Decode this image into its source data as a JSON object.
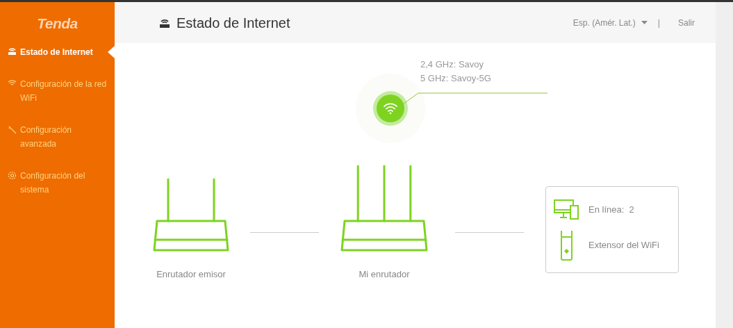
{
  "logo": "Tenda",
  "sidebar": {
    "items": [
      {
        "kind": "internet",
        "label": "Estado de Internet",
        "selected": true
      },
      {
        "kind": "wifi",
        "label": "Configuración de la red WiFi",
        "selected": false
      },
      {
        "kind": "tools",
        "label": "Configuración avanzada",
        "selected": false
      },
      {
        "kind": "gear",
        "label": "Configuración del sistema",
        "selected": false
      }
    ]
  },
  "header": {
    "title": "Estado de Internet",
    "language": "Esp. (Amér. Lat.)",
    "separator": "|",
    "logout": "Salir"
  },
  "wifi": {
    "ssid_24": "2,4 GHz: Savoy",
    "ssid_5": "5 GHz: Savoy-5G"
  },
  "diagram": {
    "upstream_label": "Enrutador emisor",
    "my_router_label": "Mi enrutador",
    "clients": [
      {
        "kind": "devices",
        "label": "En línea:",
        "value": "2"
      },
      {
        "kind": "extender",
        "label": "Extensor del WiFi"
      }
    ]
  }
}
